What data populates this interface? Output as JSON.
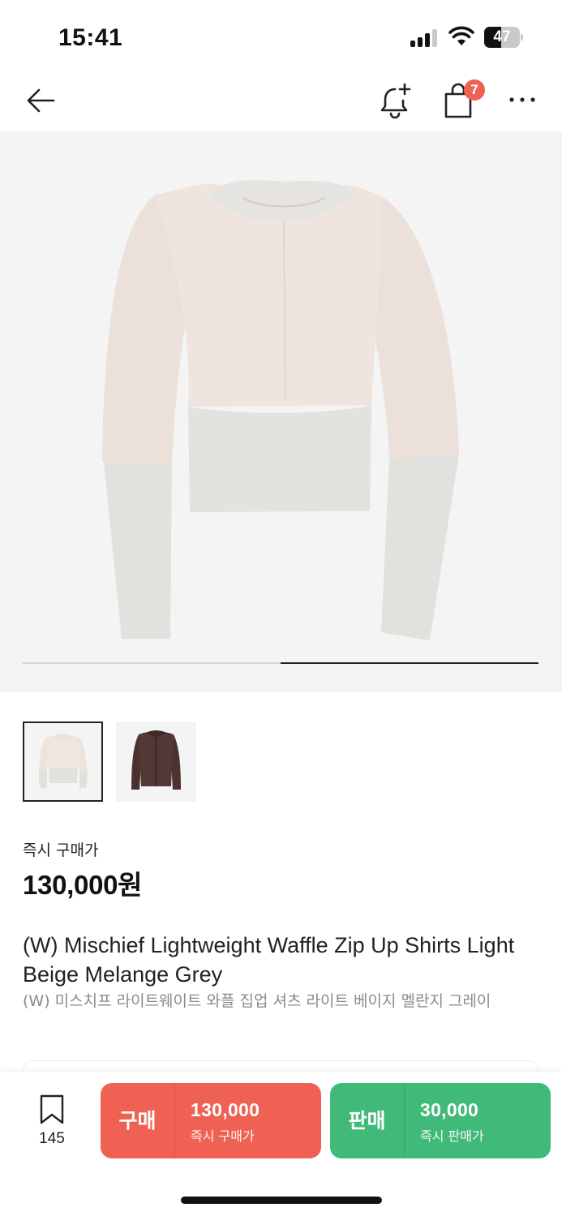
{
  "status_bar": {
    "time": "15:41",
    "battery": "47",
    "battery_level": 0.47
  },
  "nav": {
    "back_icon": "arrow-left-icon",
    "alert_icon": "bell-plus-icon",
    "bag_icon": "shopping-bag-icon",
    "bag_badge": "7",
    "more_icon": "ellipsis-icon",
    "badge_color": "#ef6253"
  },
  "gallery": {
    "progress": {
      "page": 2,
      "total": 2
    },
    "thumbnails": [
      {
        "name": "Light Beige Melange Grey",
        "active": true
      },
      {
        "name": "Brown",
        "active": false
      }
    ]
  },
  "product": {
    "price_label": "즉시 구매가",
    "price": "130,000원",
    "title_en": "(W) Mischief Lightweight Waffle Zip Up Shirts Light Beige Melange Grey",
    "title_ko": "(W) 미스치프 라이트웨이트 와플 집업 셔츠 라이트 베이지 멜란지 그레이"
  },
  "bottom_bar": {
    "bookmark_icon": "bookmark-icon",
    "bookmark_count": "145",
    "buy": {
      "label": "구매",
      "amount": "130,000",
      "sub": "즉시 구매가",
      "color": "#ef6253"
    },
    "sell": {
      "label": "판매",
      "amount": "30,000",
      "sub": "즉시 판매가",
      "color": "#41b979"
    }
  }
}
